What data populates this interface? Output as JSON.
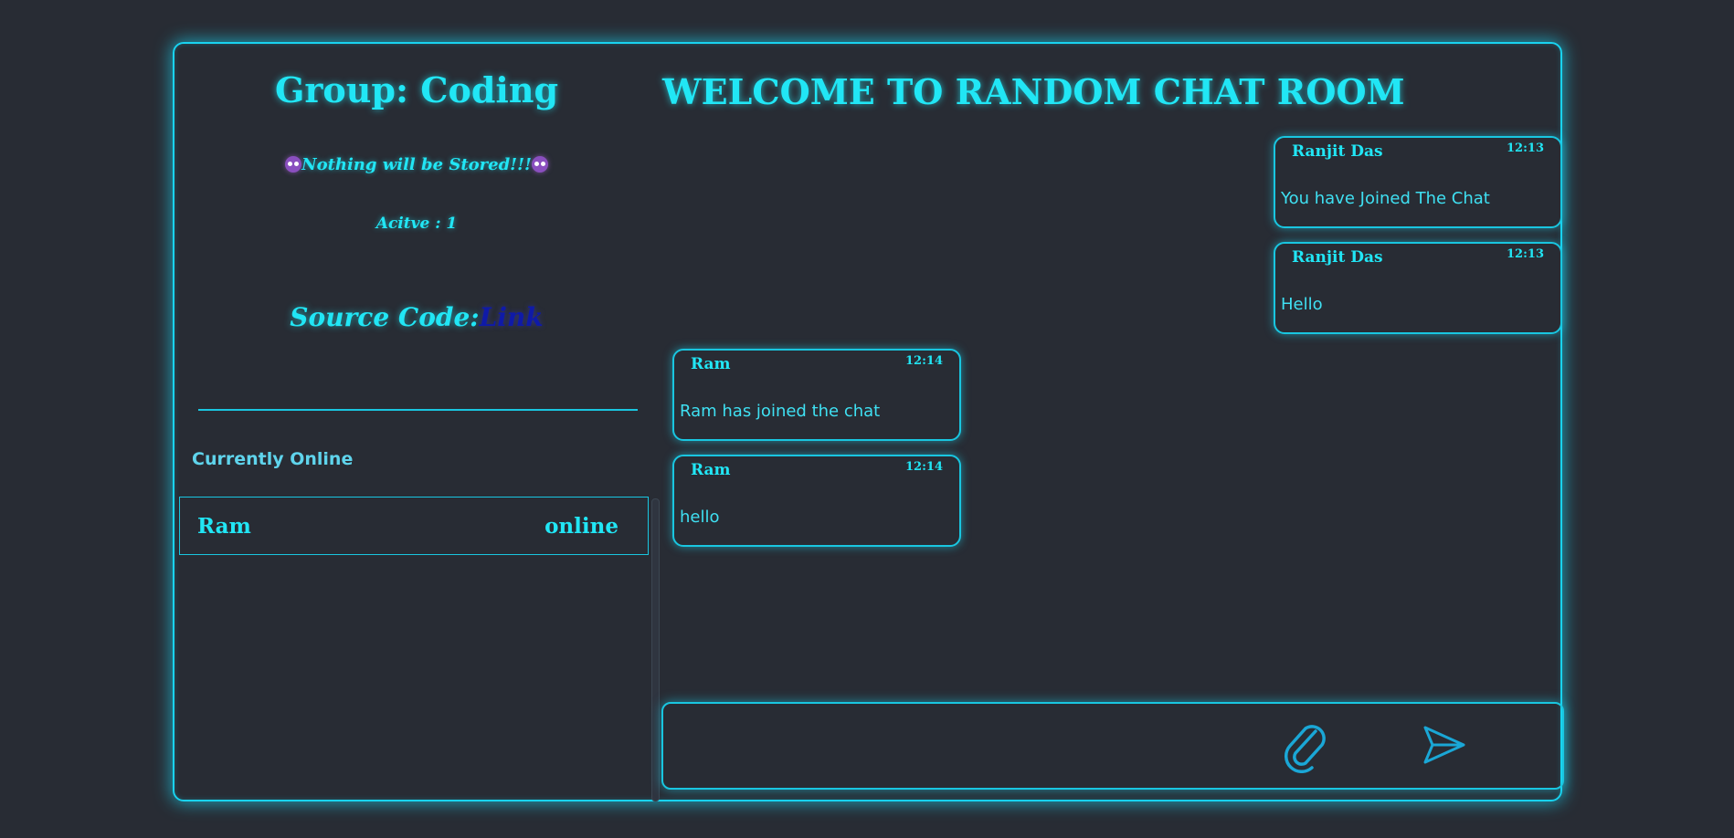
{
  "left_panel": {
    "group_title": "Group: Coding",
    "notice_text": "Nothing will be Stored!!!",
    "active_text": "Acitve : 1",
    "source_label": "Source Code:",
    "source_link": "Link",
    "online_heading": "Currently Online",
    "online_users": [
      {
        "name": "Ram",
        "status": "online"
      }
    ]
  },
  "chat": {
    "title": "WELCOME TO RANDOM CHAT ROOM",
    "messages": [
      {
        "sender": "Ranjit Das",
        "time": "12:13",
        "text": "You have Joined The Chat",
        "side": "right"
      },
      {
        "sender": "Ranjit Das",
        "time": "12:13",
        "text": "Hello",
        "side": "right"
      },
      {
        "sender": "Ram",
        "time": "12:14",
        "text": "Ram has joined the chat",
        "side": "left"
      },
      {
        "sender": "Ram",
        "time": "12:14",
        "text": "hello",
        "side": "left"
      }
    ],
    "composer": {
      "placeholder": "",
      "attach_icon": "paperclip-icon",
      "send_icon": "send-icon"
    }
  },
  "colors": {
    "background": "#282c34",
    "accent": "#21e6f5",
    "link": "#0f1aa8",
    "emoji": "#8a4fbf"
  }
}
